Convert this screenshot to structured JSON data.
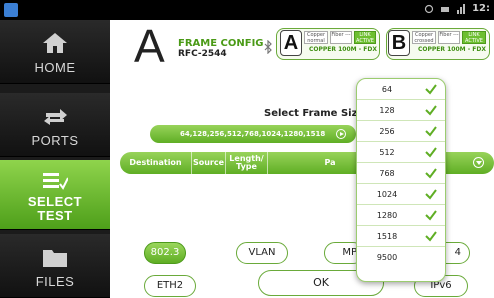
{
  "status_bar": {
    "time": "12:"
  },
  "sidebar": {
    "items": [
      {
        "label": "HOME",
        "icon": "home-icon"
      },
      {
        "label": "PORTS",
        "icon": "ports-icon"
      },
      {
        "label_line1": "SELECT",
        "label_line2": "TEST",
        "icon": "select-test-icon",
        "active": true
      },
      {
        "label": "FILES",
        "icon": "folder-icon"
      }
    ]
  },
  "header": {
    "logo_letter": "A",
    "title": "FRAME CONFIG",
    "subtitle": "RFC-2544",
    "port_a": {
      "letter": "A",
      "copper_label": "Copper normal",
      "fiber_label": "Fiber ---",
      "link_label": "LINK ACTIVE",
      "speed": "COPPER 100M - FDX"
    },
    "port_b": {
      "letter": "B",
      "copper_label": "Copper crossed",
      "fiber_label": "Fiber ---",
      "link_label": "LINK ACTIVE",
      "speed": "COPPER 100M - FDX"
    }
  },
  "frame_size": {
    "title": "Select Frame Size",
    "selected_value": "64,128,256,512,768,1024,1280,1518"
  },
  "table_header": {
    "columns": [
      "Destination",
      "Source",
      "Length/ Type",
      "Pa"
    ]
  },
  "dropdown": {
    "options": [
      {
        "value": "64",
        "checked": true
      },
      {
        "value": "128",
        "checked": true
      },
      {
        "value": "256",
        "checked": true
      },
      {
        "value": "512",
        "checked": true
      },
      {
        "value": "768",
        "checked": true
      },
      {
        "value": "1024",
        "checked": true
      },
      {
        "value": "1280",
        "checked": true
      },
      {
        "value": "1518",
        "checked": true
      },
      {
        "value": "9500",
        "checked": false
      }
    ]
  },
  "frame_types": {
    "row1": [
      "802.3",
      "VLAN",
      "MP",
      "4"
    ],
    "row2": [
      "ETH2",
      "IPv6"
    ],
    "selected": "802.3"
  },
  "actions": {
    "ok_label": "OK"
  },
  "colors": {
    "accent_green": "#5fae24",
    "sidebar_bg": "#1b1b1b",
    "status_bar_bg": "#000000"
  }
}
